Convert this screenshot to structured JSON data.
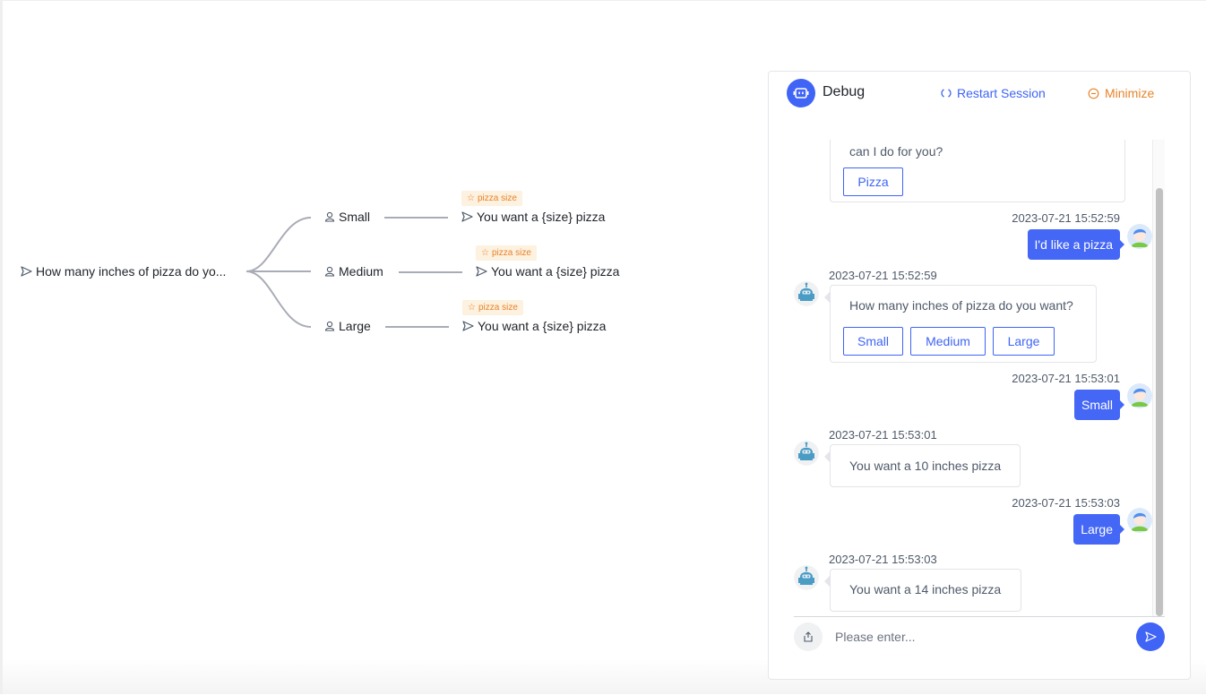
{
  "flow": {
    "root": {
      "icon": "send-icon",
      "label": "How many inches of pizza do yo..."
    },
    "branches": [
      {
        "icon": "user-icon",
        "label": "Small",
        "tag": "pizza size",
        "reply": "You want a {size} pizza"
      },
      {
        "icon": "user-icon",
        "label": "Medium",
        "tag": "pizza size",
        "reply": "You want a {size} pizza"
      },
      {
        "icon": "user-icon",
        "label": "Large",
        "tag": "pizza size",
        "reply": "You want a {size} pizza"
      }
    ],
    "colors": {
      "tag_bg": "#fdf1df",
      "tag_fg": "#e8832a",
      "connector": "#a9acb6"
    }
  },
  "debug": {
    "title": "Debug",
    "restart_label": "Restart Session",
    "minimize_label": "Minimize",
    "colors": {
      "accent": "#3f64f6",
      "minimize": "#e8832a",
      "user_bubble": "#4567f6"
    },
    "messages": [
      {
        "role": "bot",
        "text": "can I do for you?",
        "options": [
          "Pizza"
        ]
      },
      {
        "role": "user",
        "time": "2023-07-21 15:52:59",
        "text": "I'd like a pizza"
      },
      {
        "role": "bot",
        "time": "2023-07-21 15:52:59",
        "text": "How many inches of pizza do you want?",
        "options": [
          "Small",
          "Medium",
          "Large"
        ]
      },
      {
        "role": "user",
        "time": "2023-07-21 15:53:01",
        "text": "Small"
      },
      {
        "role": "bot",
        "time": "2023-07-21 15:53:01",
        "text": "You want a 10 inches pizza"
      },
      {
        "role": "user",
        "time": "2023-07-21 15:53:03",
        "text": "Large"
      },
      {
        "role": "bot",
        "time": "2023-07-21 15:53:03",
        "text": "You want a 14 inches pizza"
      }
    ],
    "input": {
      "placeholder": "Please enter...",
      "value": ""
    }
  }
}
